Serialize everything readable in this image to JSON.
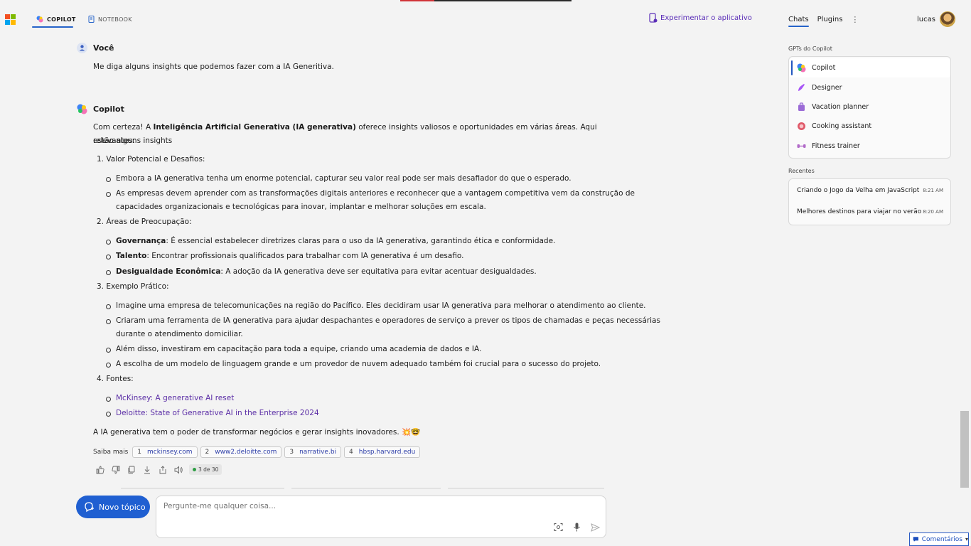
{
  "header": {
    "tabs": [
      {
        "label": "COPILOT",
        "active": true
      },
      {
        "label": "NOTEBOOK",
        "active": false
      }
    ],
    "try_app": "Experimentar o aplicativo",
    "right_tabs": {
      "chats": "Chats",
      "plugins": "Plugins"
    },
    "user_name": "lucas"
  },
  "chat": {
    "user_name": "Você",
    "user_message": "Me diga alguns insights que podemos fazer com a IA Generitiva.",
    "bot_name": "Copilot",
    "intro_1": "Com certeza! A ",
    "intro_bold": "Inteligência Artificial Generativa (IA generativa)",
    "intro_2": " oferece insights valiosos e oportunidades em várias áreas. Aqui estão alguns insights",
    "intro_3": "relevantes:",
    "sections": [
      {
        "num": "1.",
        "title": "Valor Potencial e Desafios:"
      },
      {
        "num": "2.",
        "title": "Áreas de Preocupação:"
      },
      {
        "num": "3.",
        "title": "Exemplo Prático:"
      },
      {
        "num": "4.",
        "title": "Fontes:"
      }
    ],
    "s1_b1": "Embora a IA generativa tenha um enorme potencial, capturar seu valor real pode ser mais desafiador do que o esperado.",
    "s1_b2a": "As empresas devem aprender com as transformações digitais anteriores e reconhecer que a vantagem competitiva vem da construção de",
    "s1_b2b": "capacidades organizacionais e tecnológicas para inovar, implantar e melhorar soluções em escala.",
    "s2_b1_bold": "Governança",
    "s2_b1": ": É essencial estabelecer diretrizes claras para o uso da IA generativa, garantindo ética e conformidade.",
    "s2_b2_bold": "Talento",
    "s2_b2": ": Encontrar profissionais qualificados para trabalhar com IA generativa é um desafio.",
    "s2_b3_bold": "Desigualdade Econômica",
    "s2_b3": ": A adoção da IA generativa deve ser equitativa para evitar acentuar desigualdades.",
    "s3_b1": "Imagine uma empresa de telecomunicações na região do Pacífico. Eles decidiram usar IA generativa para melhorar o atendimento ao cliente.",
    "s3_b2a": "Criaram uma ferramenta de IA generativa para ajudar despachantes e operadores de serviço a prever os tipos de chamadas e peças necessárias",
    "s3_b2b": "durante o atendimento domiciliar.",
    "s3_b3": "Além disso, investiram em capacitação para toda a equipe, criando uma academia de dados e IA.",
    "s3_b4": "A escolha de um modelo de linguagem grande e um provedor de nuvem adequado também foi crucial para o sucesso do projeto.",
    "s4_l1": "McKinsey: A generative AI reset",
    "s4_l2": "Deloitte: State of Generative AI in the Enterprise 2024",
    "closing": "A IA generativa tem o poder de transformar negócios e gerar insights inovadores. 💥🤓",
    "learn_more_label": "Saiba mais",
    "sources": [
      {
        "n": "1",
        "domain": "mckinsey.com"
      },
      {
        "n": "2",
        "domain": "www2.deloitte.com"
      },
      {
        "n": "3",
        "domain": "narrative.bi"
      },
      {
        "n": "4",
        "domain": "hbsp.harvard.edu"
      }
    ],
    "counter": "3 de 30"
  },
  "input": {
    "new_topic": "Novo tópico",
    "placeholder": "Pergunte-me qualquer coisa..."
  },
  "sidebar": {
    "gpts_label": "GPTs do Copilot",
    "gpts": [
      {
        "label": "Copilot",
        "color": "#3b82f6"
      },
      {
        "label": "Designer",
        "color": "#a855f7"
      },
      {
        "label": "Vacation planner",
        "color": "#9b6bd6"
      },
      {
        "label": "Cooking assistant",
        "color": "#e05a6a"
      },
      {
        "label": "Fitness trainer",
        "color": "#b26cc9"
      }
    ],
    "recent_label": "Recentes",
    "recent": [
      {
        "title": "Criando o Jogo da Velha em JavaScript",
        "time": "8:21 AM"
      },
      {
        "title": "Melhores destinos para viajar no verão",
        "time": "8:20 AM"
      }
    ]
  },
  "feedback": "Comentários"
}
